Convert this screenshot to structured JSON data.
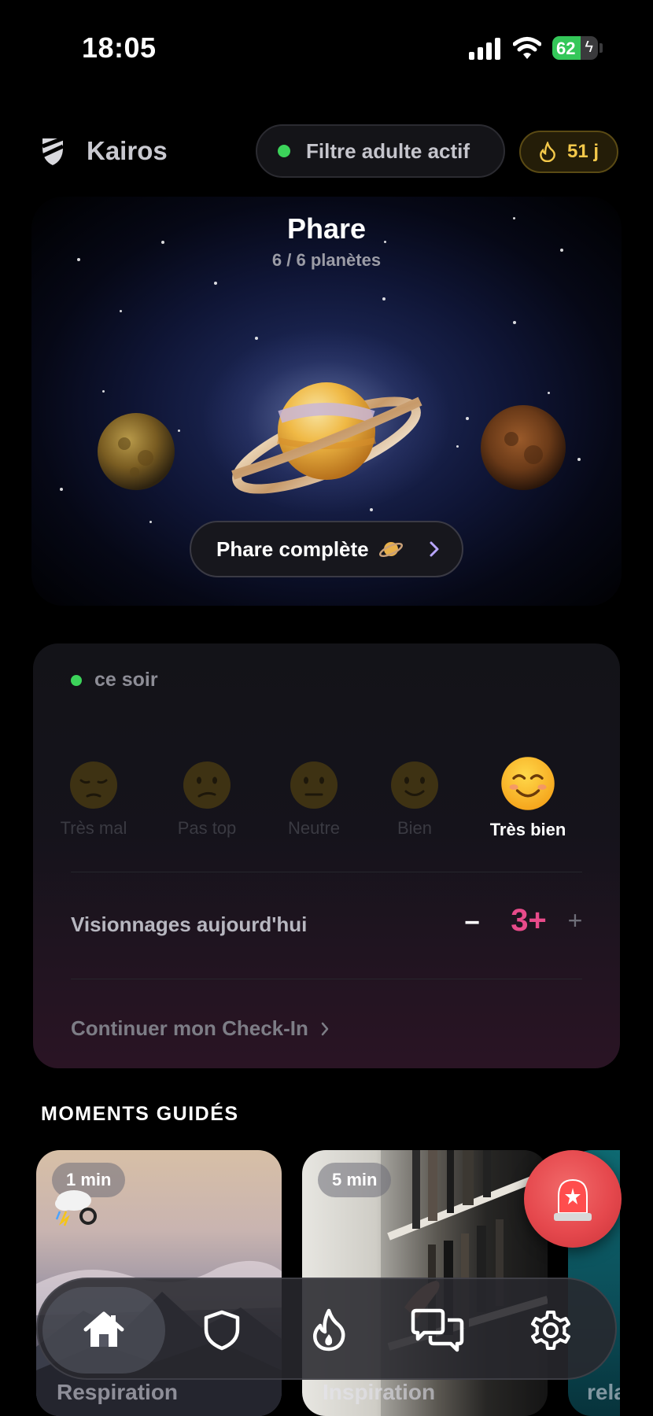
{
  "status_bar": {
    "time": "18:05",
    "battery": "62",
    "battery_level": 0.62
  },
  "header": {
    "brand": "Kairos",
    "filter_label": "Filtre adulte actif",
    "streak": "51 j"
  },
  "hero": {
    "title": "Phare",
    "subtitle": "6 / 6 planètes",
    "button_label": "Phare complète"
  },
  "checkin": {
    "period": "ce soir",
    "moods": [
      {
        "label": "Très mal",
        "icon": "pensive-face-icon"
      },
      {
        "label": "Pas top",
        "icon": "confused-face-icon"
      },
      {
        "label": "Neutre",
        "icon": "neutral-face-icon"
      },
      {
        "label": "Bien",
        "icon": "slight-smile-face-icon"
      },
      {
        "label": "Très bien",
        "icon": "smiling-face-icon"
      }
    ],
    "selected_mood": "Très bien",
    "views_label": "Visionnages aujourd'hui",
    "views_value": "3+",
    "minus": "−",
    "plus": "+",
    "continue_label": "Continuer mon Check-In"
  },
  "guided": {
    "section_title": "MOMENTS GUIDÉS",
    "cards": [
      {
        "duration": "1 min",
        "title": "Respiration"
      },
      {
        "duration": "5 min",
        "title": "Inspiration"
      },
      {
        "duration": "",
        "title": "rela"
      }
    ]
  },
  "tabbar": {
    "tabs": [
      {
        "icon": "home-icon",
        "active": true
      },
      {
        "icon": "shield-icon",
        "active": false
      },
      {
        "icon": "flame-icon",
        "active": false
      },
      {
        "icon": "chat-icon",
        "active": false
      },
      {
        "icon": "gear-icon",
        "active": false
      }
    ]
  },
  "colors": {
    "accent_pink": "#e84b8a",
    "green": "#3cd35a",
    "streak_gold": "#f3c84a",
    "sos_red": "#e5484d"
  }
}
